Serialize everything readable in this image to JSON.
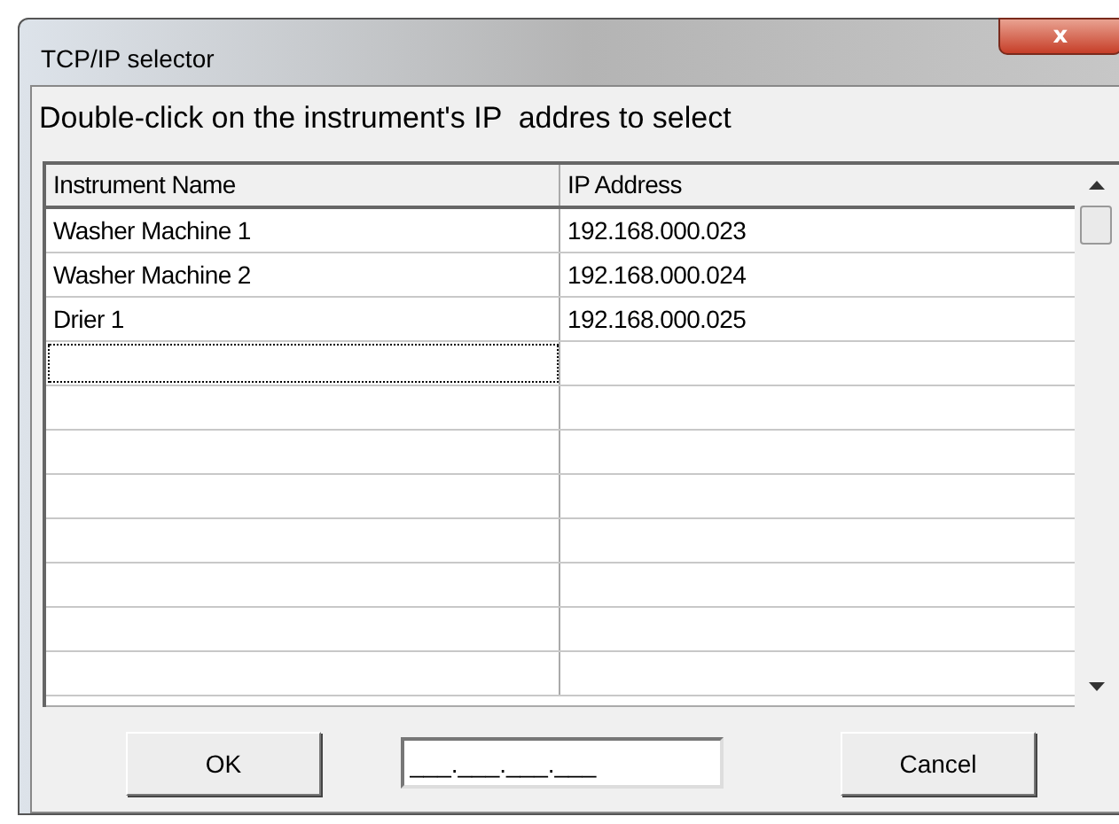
{
  "window": {
    "title": "TCP/IP selector",
    "close_icon": "x"
  },
  "instruction": "Double-click on the instrument's IP  addres to select",
  "table": {
    "columns": [
      "Instrument Name",
      "IP Address"
    ],
    "rows": [
      {
        "name": "Washer Machine 1",
        "ip": "192.168.000.023",
        "focused": false
      },
      {
        "name": "Washer Machine 2",
        "ip": "192.168.000.024",
        "focused": false
      },
      {
        "name": "Drier 1",
        "ip": "192.168.000.025",
        "focused": false
      },
      {
        "focused": true
      }
    ]
  },
  "buttons": {
    "ok": "OK",
    "cancel": "Cancel"
  },
  "ip_field": {
    "value": "___.___.___.___"
  }
}
